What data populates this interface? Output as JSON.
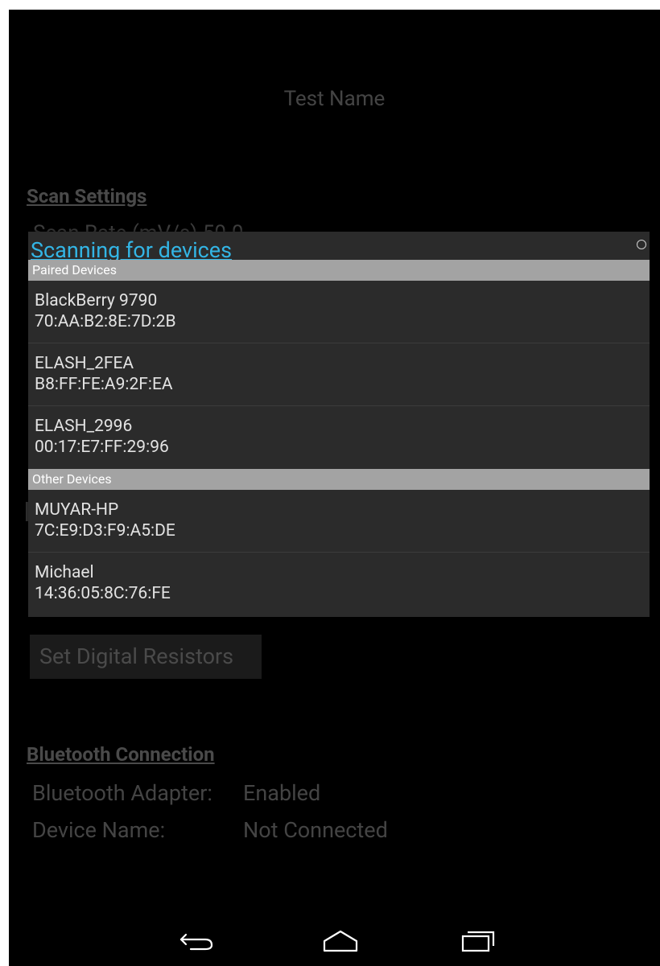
{
  "app": {
    "test_name": "Test Name"
  },
  "scan_settings": {
    "heading": "Scan Settings",
    "scan_rate_label": "Scan Rate (mV/s)",
    "scan_rate_value": "50.0"
  },
  "buttons": {
    "set_digital_resistors": "Set Digital Resistors"
  },
  "bluetooth": {
    "heading": "Bluetooth Connection",
    "adapter_label": "Bluetooth Adapter:",
    "adapter_value": "Enabled",
    "device_name_label": "Device Name:",
    "device_name_value": "Not Connected"
  },
  "dialog": {
    "title": "Scanning for devices",
    "paired_header": "Paired Devices",
    "other_header": "Other Devices",
    "paired": [
      {
        "name": "BlackBerry 9790",
        "address": "70:AA:B2:8E:7D:2B"
      },
      {
        "name": "ELASH_2FEA",
        "address": "B8:FF:FE:A9:2F:EA"
      },
      {
        "name": "ELASH_2996",
        "address": "00:17:E7:FF:29:96"
      }
    ],
    "other": [
      {
        "name": "MUYAR-HP",
        "address": "7C:E9:D3:F9:A5:DE"
      },
      {
        "name": "Michael",
        "address": "14:36:05:8C:76:FE"
      }
    ]
  },
  "icons": {
    "spinner": "progress-spinner-icon",
    "back": "back-icon",
    "home": "home-icon",
    "recents": "recent-apps-icon"
  },
  "colors": {
    "accent": "#33b5e5",
    "dialog_bg": "#2b2b2b",
    "section_header_bg": "#a3a3a3"
  }
}
